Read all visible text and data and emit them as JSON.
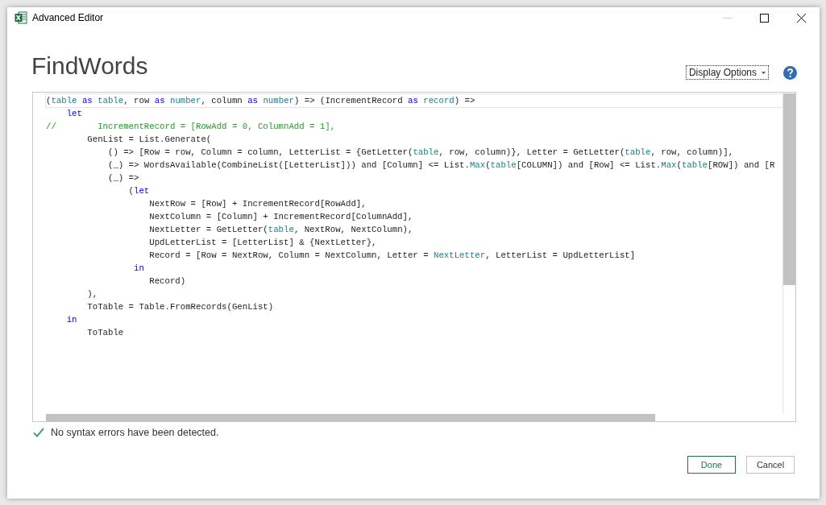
{
  "window": {
    "title": "Advanced Editor",
    "controls": [
      {
        "kind": "minimize",
        "disabled": true
      },
      {
        "kind": "maximize",
        "disabled": false
      },
      {
        "kind": "close",
        "disabled": false
      }
    ]
  },
  "query_name": "FindWords",
  "display_options": {
    "label": "Display Options"
  },
  "editor": {
    "lines": [
      {
        "tokens": [
          {
            "text": "(",
            "kind": "plain"
          },
          {
            "text": "table",
            "kind": "type"
          },
          {
            "text": " as ",
            "kind": "keyword"
          },
          {
            "text": "table",
            "kind": "type"
          },
          {
            "text": ", row ",
            "kind": "plain"
          },
          {
            "text": "as ",
            "kind": "keyword"
          },
          {
            "text": "number",
            "kind": "type"
          },
          {
            "text": ", column ",
            "kind": "plain"
          },
          {
            "text": "as ",
            "kind": "keyword"
          },
          {
            "text": "number",
            "kind": "type"
          },
          {
            "text": ") => (IncrementRecord ",
            "kind": "plain"
          },
          {
            "text": "as ",
            "kind": "keyword"
          },
          {
            "text": "record",
            "kind": "type"
          },
          {
            "text": ") =>",
            "kind": "plain"
          }
        ]
      },
      {
        "tokens": [
          {
            "text": "    let",
            "kind": "keyword"
          }
        ]
      },
      {
        "tokens": [
          {
            "text": "//        IncrementRecord = [RowAdd = 0, ColumnAdd = 1],",
            "kind": "comment"
          }
        ]
      },
      {
        "tokens": [
          {
            "text": "        GenList = List.Generate(",
            "kind": "plain"
          }
        ]
      },
      {
        "tokens": [
          {
            "text": "            () => [Row = row, Column = column, LetterList = {GetLetter(",
            "kind": "plain"
          },
          {
            "text": "table",
            "kind": "type"
          },
          {
            "text": ", row, column)}, Letter = GetLetter(",
            "kind": "plain"
          },
          {
            "text": "table",
            "kind": "type"
          },
          {
            "text": ", row, column)],",
            "kind": "plain"
          }
        ]
      },
      {
        "tokens": [
          {
            "text": "            (_) => WordsAvailable(CombineList([LetterList])) and [Column] <= List.",
            "kind": "plain"
          },
          {
            "text": "Max",
            "kind": "type"
          },
          {
            "text": "(",
            "kind": "plain"
          },
          {
            "text": "table",
            "kind": "type"
          },
          {
            "text": "[COLUMN]) and [Row] <= List.",
            "kind": "plain"
          },
          {
            "text": "Max",
            "kind": "type"
          },
          {
            "text": "(",
            "kind": "plain"
          },
          {
            "text": "table",
            "kind": "type"
          },
          {
            "text": "[ROW]) and [R",
            "kind": "plain"
          }
        ]
      },
      {
        "tokens": [
          {
            "text": "            (_) =>",
            "kind": "plain"
          }
        ]
      },
      {
        "tokens": [
          {
            "text": "                (",
            "kind": "plain"
          },
          {
            "text": "let",
            "kind": "keyword"
          }
        ]
      },
      {
        "tokens": [
          {
            "text": "                    NextRow = [Row] + IncrementRecord[RowAdd],",
            "kind": "plain"
          }
        ]
      },
      {
        "tokens": [
          {
            "text": "                    NextColumn = [Column] + IncrementRecord[ColumnAdd],",
            "kind": "plain"
          }
        ]
      },
      {
        "tokens": [
          {
            "text": "                    NextLetter = GetLetter(",
            "kind": "plain"
          },
          {
            "text": "table",
            "kind": "type"
          },
          {
            "text": ", NextRow, NextColumn),",
            "kind": "plain"
          }
        ]
      },
      {
        "tokens": [
          {
            "text": "                    UpdLetterList = [LetterList] & {NextLetter},",
            "kind": "plain"
          }
        ]
      },
      {
        "tokens": [
          {
            "text": "                    Record = [Row = NextRow, Column = NextColumn, Letter = ",
            "kind": "plain"
          },
          {
            "text": "NextLetter",
            "kind": "type"
          },
          {
            "text": ", LetterList = UpdLetterList]",
            "kind": "plain"
          }
        ]
      },
      {
        "tokens": [
          {
            "text": "                 in",
            "kind": "keyword"
          }
        ]
      },
      {
        "tokens": [
          {
            "text": "                    Record)",
            "kind": "plain"
          }
        ]
      },
      {
        "tokens": [
          {
            "text": "        ),",
            "kind": "plain"
          }
        ]
      },
      {
        "tokens": [
          {
            "text": "        ToTable = Table.FromRecords(GenList)",
            "kind": "plain"
          }
        ]
      },
      {
        "tokens": [
          {
            "text": "    in",
            "kind": "keyword"
          }
        ]
      },
      {
        "tokens": [
          {
            "text": "        ToTable",
            "kind": "plain"
          }
        ]
      }
    ]
  },
  "status": {
    "message": "No syntax errors have been detected.",
    "ok": true
  },
  "buttons": [
    {
      "label": "Done",
      "kind": "primary"
    },
    {
      "label": "Cancel",
      "kind": "secondary"
    }
  ]
}
